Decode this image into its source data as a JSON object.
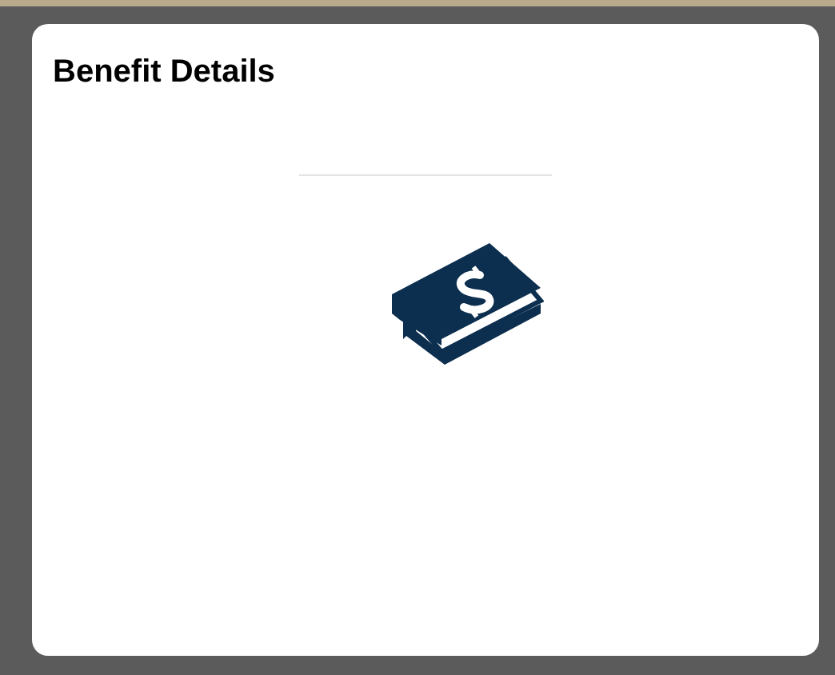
{
  "tile": {
    "title": "Benefit Details"
  }
}
